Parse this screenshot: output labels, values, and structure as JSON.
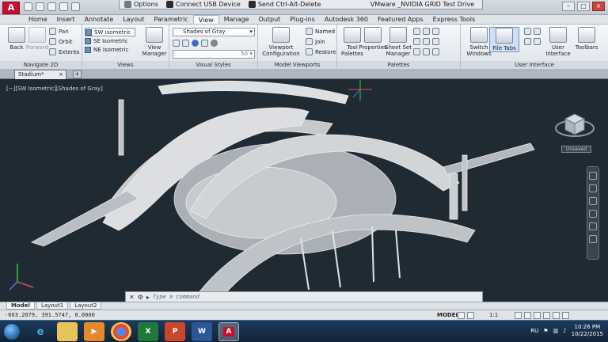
{
  "window": {
    "title": "VMware _NVIDIA GRID Test Drive",
    "quick_access_icons": [
      "new-icon",
      "open-icon",
      "save-icon",
      "undo-icon",
      "redo-icon"
    ]
  },
  "vmware_bar": {
    "options": "Options",
    "connect_usb": "Connect USB Device",
    "send_cad": "Send Ctrl-Alt-Delete",
    "title": "VMware _NVIDIA GRID Test Drive"
  },
  "tabs": [
    "Home",
    "Insert",
    "Annotate",
    "Layout",
    "Parametric",
    "View",
    "Manage",
    "Output",
    "Plug-ins",
    "Autodesk 360",
    "Featured Apps",
    "Express Tools"
  ],
  "active_tab": "View",
  "ribbon": {
    "navigate": {
      "title": "Navigate 2D",
      "back": "Back",
      "forward": "Forward",
      "pan": "Pan",
      "orbit": "Orbit",
      "extents": "Extents"
    },
    "views": {
      "title": "Views",
      "items": [
        "SW Isometric",
        "SE Isometric",
        "NE Isometric"
      ],
      "view_manager": "View Manager"
    },
    "visual_styles": {
      "title": "Visual Styles",
      "style": "Shades of Gray",
      "opacity": "50"
    },
    "model_viewports": {
      "title": "Model Viewports",
      "viewport_config": "Viewport Configuration",
      "named": "Named",
      "join": "Join",
      "restore": "Restore"
    },
    "palettes": {
      "title": "Palettes",
      "tool_palettes": "Tool Palettes",
      "properties": "Properties",
      "sheet_set": "Sheet Set Manager"
    },
    "user_interface": {
      "title": "User Interface",
      "switch_windows": "Switch Windows",
      "file_tabs": "File Tabs",
      "user_interface": "User Interface",
      "toolbars": "Toolbars"
    }
  },
  "file_tabs": {
    "current": "Stadium*"
  },
  "viewport": {
    "label": "[−][SW Isometric][Shades of Gray]",
    "cube_text": "Unsaved"
  },
  "command": {
    "placeholder": "Type a command"
  },
  "layout_tabs": [
    "Model",
    "Layout1",
    "Layout2"
  ],
  "active_layout": "Model",
  "status": {
    "coords": "-603.2079, 391.5747, 0.0000",
    "model": "MODEL",
    "scale": "1:1"
  },
  "taskbar": {
    "apps": [
      "ie-icon",
      "explorer-icon",
      "media-player-icon",
      "chrome-icon",
      "excel-icon",
      "powerpoint-icon",
      "word-icon",
      "autocad-icon"
    ],
    "language": "RU",
    "time": "10:26 PM",
    "date": "10/22/2015"
  },
  "colors": {
    "accent": "#c8102e",
    "canvas": "#202a33",
    "taskbar": "#1e3a5a"
  }
}
